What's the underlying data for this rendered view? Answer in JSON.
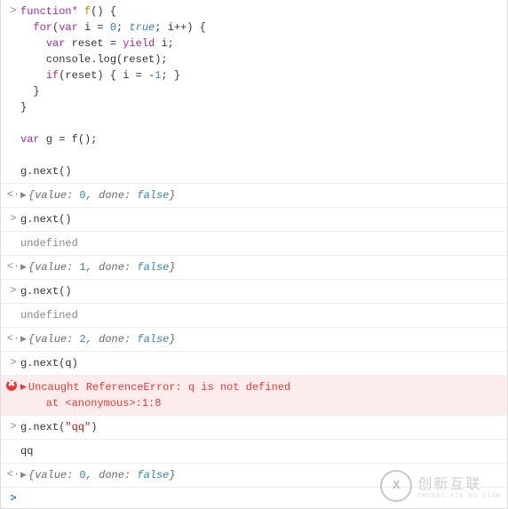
{
  "glyphs": {
    "input": ">",
    "output": "<·",
    "triangle": "▶",
    "error": "✖"
  },
  "code_block": {
    "raw": "function* f() {\n  for(var i = 0; true; i++) {\n    var reset = yield i;\n    console.log(reset);\n    if(reset) { i = -1; }\n  }\n}\n\nvar g = f();\n\ng.next()"
  },
  "entries": [
    {
      "kind": "output-obj",
      "obj": {
        "value": "0",
        "done": "false"
      }
    },
    {
      "kind": "input",
      "text": "g.next()"
    },
    {
      "kind": "log",
      "text": "undefined"
    },
    {
      "kind": "output-obj",
      "obj": {
        "value": "1",
        "done": "false"
      }
    },
    {
      "kind": "input",
      "text": "g.next()"
    },
    {
      "kind": "log",
      "text": "undefined"
    },
    {
      "kind": "output-obj",
      "obj": {
        "value": "2",
        "done": "false"
      }
    },
    {
      "kind": "input",
      "text": "g.next(q)"
    },
    {
      "kind": "error",
      "message": "Uncaught ReferenceError: q is not defined",
      "trace": "    at <anonymous>:1:8"
    },
    {
      "kind": "input",
      "text": "g.next(\"qq\")"
    },
    {
      "kind": "log",
      "text": "qq"
    },
    {
      "kind": "output-obj",
      "obj": {
        "value": "0",
        "done": "false"
      }
    }
  ],
  "watermark": {
    "badge": "X",
    "main": "创新互联",
    "sub": "CHUANG XIN HU LIAN"
  }
}
